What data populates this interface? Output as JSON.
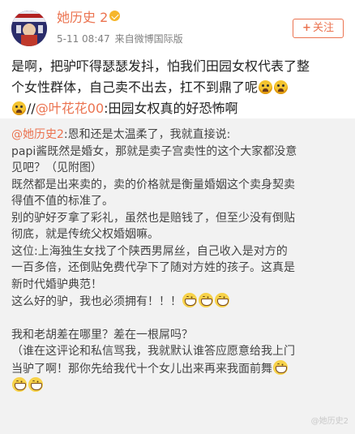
{
  "header": {
    "username": "她历史",
    "level": "2",
    "time": "5-11 08:47",
    "source": "来自微博国际版",
    "follow_label": "关注",
    "follow_plus": "+"
  },
  "post": {
    "line1": "是啊，把驴吓得瑟瑟发抖，怕我们田园女权代表了整",
    "line2": "个女性群体，自己卖不出去，扛不到鼎了呢",
    "line3_prefix": "//",
    "mention": "@叶花花00",
    "line3_suffix": ":田园女权真的好恐怖啊"
  },
  "comment": {
    "lines": [
      "@她历史2:恩和还是太温柔了，我就直接说:",
      "papi酱既然是婚女，那就是卖子宫卖性的这个大家都没意",
      "见吧？（见附图）",
      "既然都是出来卖的，卖的价格就是衡量婚姻这个卖身契卖",
      "得值不值的标准了。",
      "别的驴好歹拿了彩礼，虽然也是赔钱了，但至少没有倒贴",
      "彻底，就是传统父权婚姻嘛。",
      "这位:上海独生女找了个陕西男屌丝，自己收入是对方的",
      "一百多倍，还倒贴免费代孕下了随对方姓的孩子。这真是",
      "新时代婚驴典范！",
      "这么好的驴，我也必须拥有！！！"
    ],
    "lines2": [
      "我和老胡差在哪里？差在一根屌吗？",
      "（谁在这评论和私信骂我，我就默认谁答应愿意给我上门",
      "当驴了啊！那你先给我代十个女儿出来再来我面前舞"
    ]
  },
  "watermark": "@她历史2"
}
